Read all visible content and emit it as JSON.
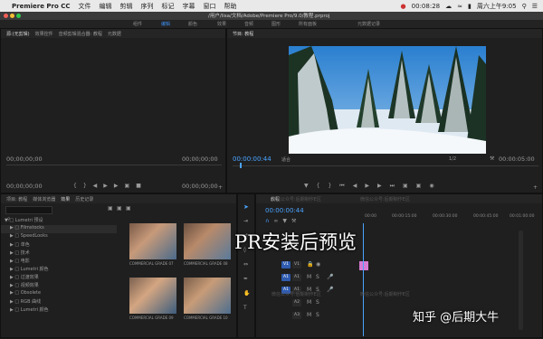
{
  "menubar": {
    "apple": "",
    "app_name": "Premiere Pro CC",
    "items": [
      "文件",
      "编辑",
      "剪辑",
      "序列",
      "标记",
      "字幕",
      "窗口",
      "帮助"
    ],
    "clock": "00:08:28",
    "date": "周六上午9:05"
  },
  "window": {
    "path": "/用户/lisa/文档/Adobe/Premiere Pro/9.0/教程.prproj"
  },
  "workspaces": [
    {
      "label": "组件",
      "active": false
    },
    {
      "label": "编辑",
      "active": true
    },
    {
      "label": "颜色",
      "active": false
    },
    {
      "label": "效果",
      "active": false
    },
    {
      "label": "音频",
      "active": false
    },
    {
      "label": "图形",
      "active": false
    },
    {
      "label": "所有面板",
      "active": false
    },
    {
      "label": "元数据记录",
      "active": false
    }
  ],
  "source_panel": {
    "tabs": [
      "源:(无剪辑)",
      "效果控件",
      "音频剪辑混合器: 教程",
      "元数据"
    ],
    "tc_left": "00;00;00;00",
    "tc_right": "00;00;00;00",
    "tc_left2": "00;00;00;00",
    "tc_right2": "00;00;00;00"
  },
  "program_panel": {
    "tab": "节目: 教程",
    "current_tc": "00:00:00:44",
    "fit": "适合",
    "ratio": "1/2",
    "duration": "00:00:05:00"
  },
  "project_panel": {
    "tabs": [
      "项目: 教程",
      "媒体浏览器",
      "效果",
      "历史记录"
    ],
    "search": "",
    "tree": [
      "Lumetri 预设",
      "Filmstocks",
      "SpeedLooks",
      "单色",
      "技术",
      "电影",
      "Lumetri 颜色",
      "过渡效果",
      "视频效果",
      "Obsolete",
      "RGB 曲线",
      "Lumetri 颜色"
    ],
    "tree_header": "Lumetri 预设",
    "thumbs": [
      "COMMERCIAL GRADE 07",
      "COMMERCIAL GRADE 08",
      "COMMERCIAL GRADE 09",
      "COMMERCIAL GRADE 10"
    ]
  },
  "timeline": {
    "tab": "教程",
    "tc": "00:00:00:44",
    "ruler": [
      "00:00",
      "00:00:15:00",
      "00:00:30:00",
      "00:00:45:00",
      "00:01:00:00"
    ],
    "tracks": [
      "V1",
      "V1",
      "A1",
      "A1",
      "A2",
      "A3"
    ]
  },
  "watermark_text": "微信公众号:后期制作E区",
  "overlay": {
    "caption": "PR安装后预览",
    "brand": "知乎 @后期大牛"
  }
}
